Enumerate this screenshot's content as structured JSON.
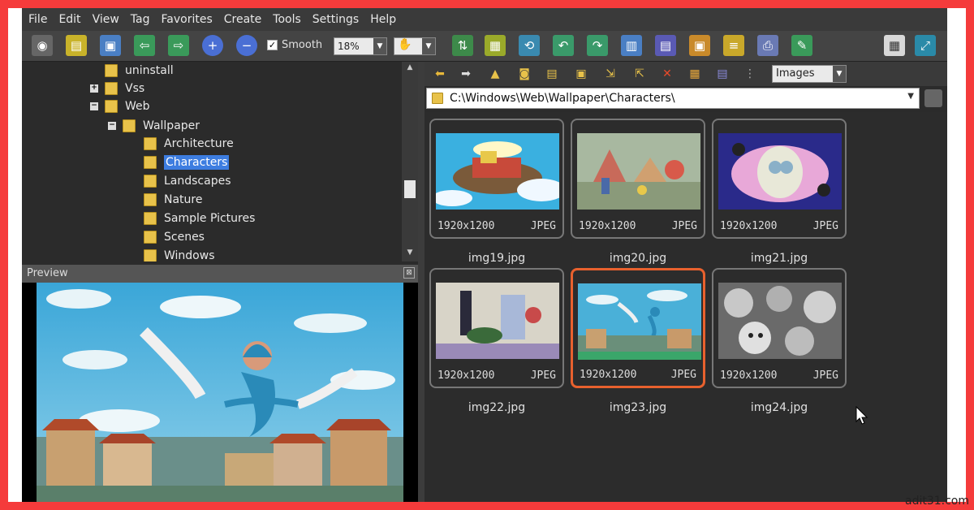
{
  "menu": [
    "File",
    "Edit",
    "View",
    "Tag",
    "Favorites",
    "Create",
    "Tools",
    "Settings",
    "Help"
  ],
  "toolbar": {
    "smooth_label": "Smooth",
    "smooth_checked": "✓",
    "zoom_value": "18%",
    "hand_icon": "✋"
  },
  "tree": {
    "items": [
      {
        "label": "uninstall",
        "toggle": ""
      },
      {
        "label": "Vss",
        "toggle": "+"
      },
      {
        "label": "Web",
        "toggle": "−"
      },
      {
        "label": "Wallpaper",
        "toggle": "−"
      },
      {
        "label": "Architecture",
        "toggle": ""
      },
      {
        "label": "Characters",
        "toggle": ""
      },
      {
        "label": "Landscapes",
        "toggle": ""
      },
      {
        "label": "Nature",
        "toggle": ""
      },
      {
        "label": "Sample Pictures",
        "toggle": ""
      },
      {
        "label": "Scenes",
        "toggle": ""
      },
      {
        "label": "Windows",
        "toggle": ""
      }
    ],
    "selected": "Characters"
  },
  "preview": {
    "title": "Preview",
    "close_glyph": "⊠"
  },
  "browser": {
    "filter_value": "Images",
    "path": "C:\\Windows\\Web\\Wallpaper\\Characters\\",
    "thumbnails": [
      {
        "name": "img19.jpg",
        "dims": "1920x1200",
        "format": "JPEG",
        "selected": false
      },
      {
        "name": "img20.jpg",
        "dims": "1920x1200",
        "format": "JPEG",
        "selected": false
      },
      {
        "name": "img21.jpg",
        "dims": "1920x1200",
        "format": "JPEG",
        "selected": false
      },
      {
        "name": "img22.jpg",
        "dims": "1920x1200",
        "format": "JPEG",
        "selected": false
      },
      {
        "name": "img23.jpg",
        "dims": "1920x1200",
        "format": "JPEG",
        "selected": true
      },
      {
        "name": "img24.jpg",
        "dims": "1920x1200",
        "format": "JPEG",
        "selected": false
      }
    ]
  },
  "watermark": "adit31.com",
  "colors": {
    "selection_border": "#e8612e",
    "tree_selection": "#3d7de0",
    "frame": "#f53b3b"
  }
}
